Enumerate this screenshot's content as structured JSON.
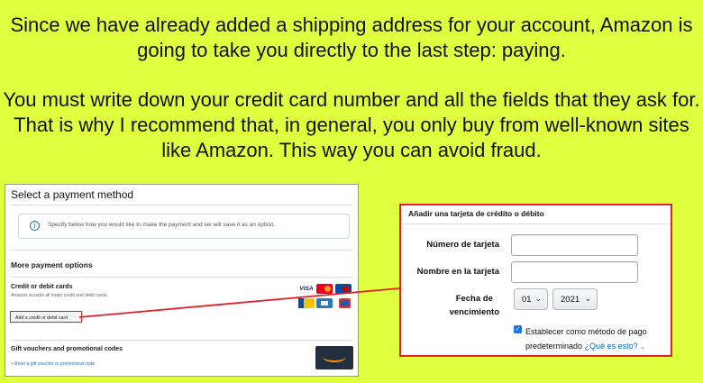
{
  "intro": {
    "paragraph1": "Since we have already added a shipping address for your account, Amazon is going to take you directly to the last step: paying.",
    "paragraph2": "You must write down your credit card number and all the fields that they ask for. That is why I recommend that, in general, you only buy from well-known sites like Amazon. This way you can avoid fraud."
  },
  "payment_panel": {
    "title": "Select a payment method",
    "info_text": "Specify below how you would like to make the payment and we will save it as an option.",
    "more_options_title": "More payment options",
    "cards_title": "Credit or debit cards",
    "cards_subtitle": "Amazon accepts all major credit and debit cards.",
    "add_card_label": "Add a credit or debit card",
    "gift_title": "Gift vouchers and promotional codes",
    "gift_link": "+ Enter a gift voucher or promotional code",
    "card_logos": [
      "visa",
      "mastercard",
      "maestro",
      "jcb",
      "amex",
      "other-card"
    ],
    "visa_text": "VISA"
  },
  "card_form": {
    "title": "Añadir una tarjeta de crédito o débito",
    "card_number_label": "Número de tarjeta",
    "card_name_label": "Nombre en la tarjeta",
    "expiry_label_line1": "Fecha de",
    "expiry_label_line2": "vencimiento",
    "month_value": "01",
    "year_value": "2021",
    "default_line1": "Establecer como método de pago",
    "default_line2": "predeterminado",
    "what_is_this": "¿Qué es esto?",
    "default_checked": true
  },
  "colors": {
    "background": "#dfff3f",
    "highlight": "#e0202a",
    "link": "#0066c0"
  }
}
